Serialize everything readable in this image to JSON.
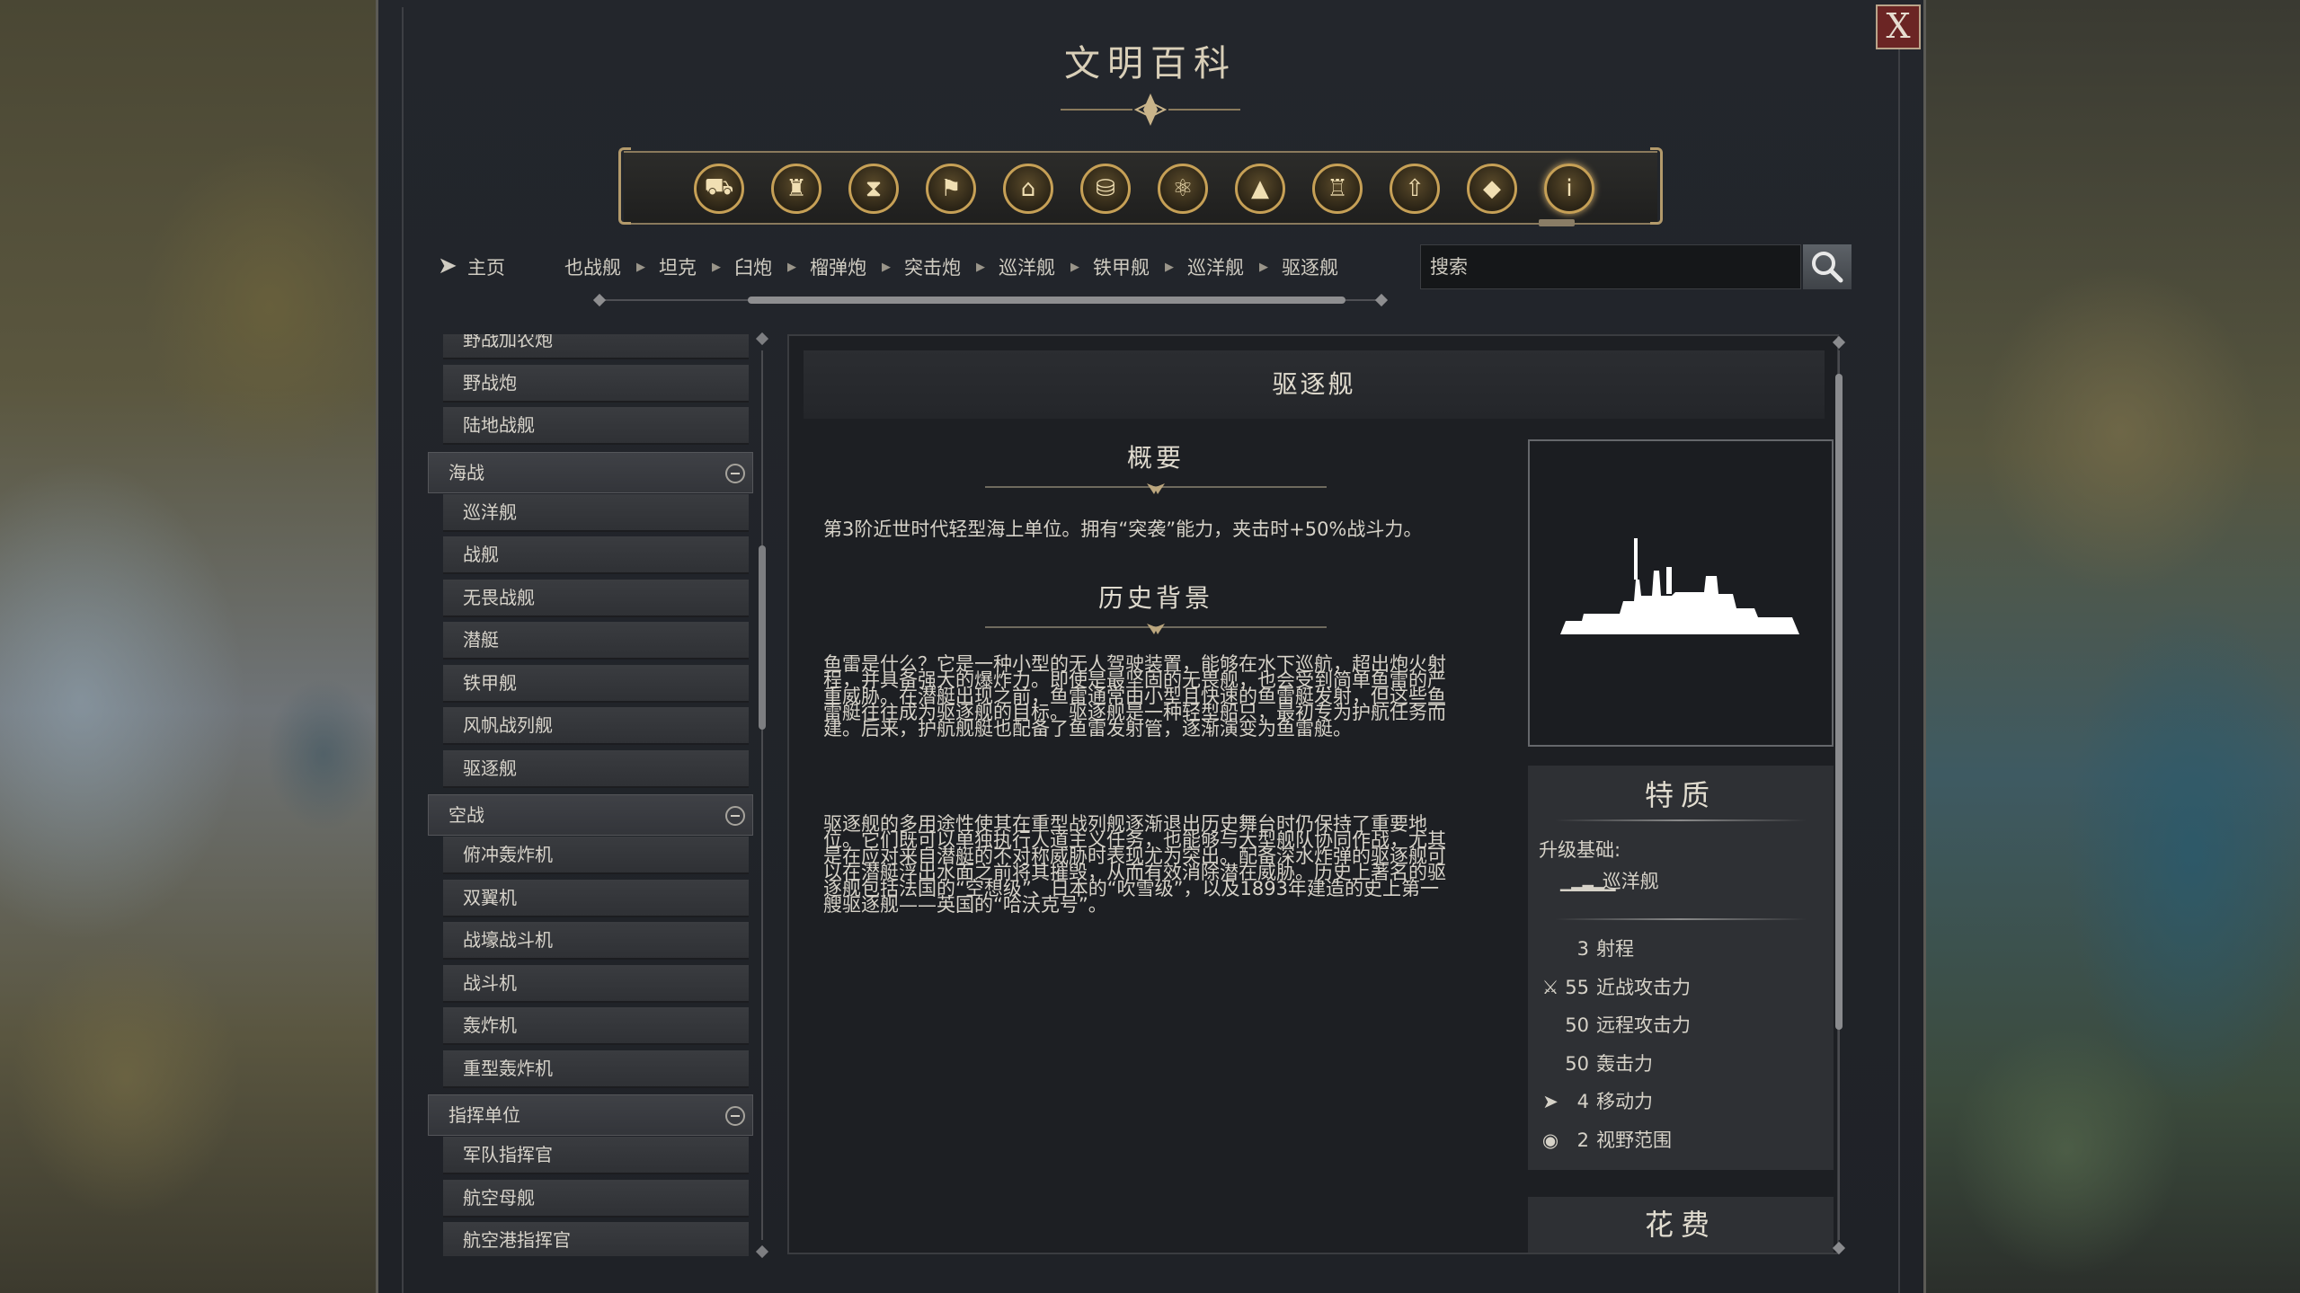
{
  "window": {
    "title": "文明百科",
    "close_label": "X"
  },
  "categories": [
    {
      "icon": "units-icon"
    },
    {
      "icon": "buildings-icon"
    },
    {
      "icon": "eras-icon"
    },
    {
      "icon": "governments-icon"
    },
    {
      "icon": "districts-icon"
    },
    {
      "icon": "resources-icon"
    },
    {
      "icon": "technology-icon"
    },
    {
      "icon": "terrain-icon"
    },
    {
      "icon": "wonders-icon"
    },
    {
      "icon": "promotions-icon"
    },
    {
      "icon": "concepts-icon"
    },
    {
      "icon": "info-icon"
    }
  ],
  "nav": {
    "home_label": "主页",
    "breadcrumbs": [
      "也战舰",
      "坦克",
      "臼炮",
      "榴弹炮",
      "突击炮",
      "巡洋舰",
      "铁甲舰",
      "巡洋舰",
      "驱逐舰"
    ]
  },
  "search": {
    "placeholder": "搜索"
  },
  "sidebar": {
    "items": [
      {
        "type": "item",
        "label": "野战加农炮"
      },
      {
        "type": "item",
        "label": "野战炮"
      },
      {
        "type": "item",
        "label": "陆地战舰"
      },
      {
        "type": "group",
        "label": "海战"
      },
      {
        "type": "item",
        "label": "巡洋舰"
      },
      {
        "type": "item",
        "label": "战舰"
      },
      {
        "type": "item",
        "label": "无畏战舰"
      },
      {
        "type": "item",
        "label": "潜艇"
      },
      {
        "type": "item",
        "label": "铁甲舰"
      },
      {
        "type": "item",
        "label": "风帆战列舰"
      },
      {
        "type": "item",
        "label": "驱逐舰"
      },
      {
        "type": "group",
        "label": "空战"
      },
      {
        "type": "item",
        "label": "俯冲轰炸机"
      },
      {
        "type": "item",
        "label": "双翼机"
      },
      {
        "type": "item",
        "label": "战壕战斗机"
      },
      {
        "type": "item",
        "label": "战斗机"
      },
      {
        "type": "item",
        "label": "轰炸机"
      },
      {
        "type": "item",
        "label": "重型轰炸机"
      },
      {
        "type": "group",
        "label": "指挥单位"
      },
      {
        "type": "item",
        "label": "军队指挥官"
      },
      {
        "type": "item",
        "label": "航空母舰"
      },
      {
        "type": "item",
        "label": "航空港指挥官"
      }
    ]
  },
  "article": {
    "title": "驱逐舰",
    "overview_title": "概要",
    "overview_text": "第3阶近世时代轻型海上单位。拥有“突袭”能力，夹击时+50%战斗力。",
    "history_title": "历史背景",
    "history_p1": "鱼雷是什么？它是一种小型的无人驾驶装置，能够在水下巡航，超出炮火射程，并具备强大的爆炸力。即使是最坚固的无畏舰，也会受到简单鱼雷的严重威胁。在潜艇出现之前，鱼雷通常由小型且快速的鱼雷艇发射，但这些鱼雷艇往往成为驱逐舰的目标。驱逐舰是一种轻型船只，最初专为护航任务而建。后来，护航舰艇也配备了鱼雷发射管，逐渐演变为鱼雷艇。",
    "history_p2": "驱逐舰的多用途性使其在重型战列舰逐渐退出历史舞台时仍保持了重要地位。它们既可以单独执行人道主义任务，也能够与大型舰队协同作战，尤其是在应对来自潜艇的不对称威胁时表现尤为突出。配备深水炸弹的驱逐舰可以在潜艇浮出水面之前将其摧毁，从而有效消除潜在威胁。历史上著名的驱逐舰包括法国的“空想级”、日本的“吹雪级”，以及1893年建造的史上第一艘驱逐舰——英国的“哈沃克号”。"
  },
  "traits": {
    "title": "特质",
    "upgrade_label": "升级基础:",
    "upgrade_from": "巡洋舰",
    "stats": [
      {
        "icon": "",
        "value": "3",
        "label": "射程"
      },
      {
        "icon": "sword-icon",
        "value": "55",
        "label": "近战攻击力"
      },
      {
        "icon": "",
        "value": "50",
        "label": "远程攻击力"
      },
      {
        "icon": "",
        "value": "50",
        "label": "轰击力"
      },
      {
        "icon": "movement-icon",
        "value": "4",
        "label": "移动力"
      },
      {
        "icon": "eye-icon",
        "value": "2",
        "label": "视野范围"
      }
    ]
  },
  "cost": {
    "title": "花费"
  },
  "colors": {
    "accent_gold": "#c6a056",
    "close_red": "#6b2524",
    "panel_bg": "#1f2227"
  }
}
